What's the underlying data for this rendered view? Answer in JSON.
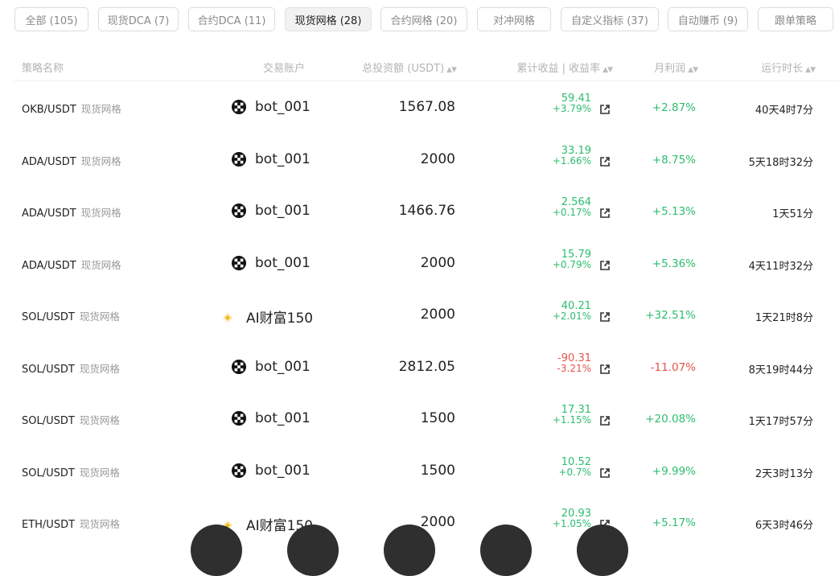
{
  "tabs": [
    {
      "label": "全部 (105)",
      "active": false
    },
    {
      "label": "现货DCA (7)",
      "active": false
    },
    {
      "label": "合约DCA (11)",
      "active": false
    },
    {
      "label": "现货网格 (28)",
      "active": true
    },
    {
      "label": "合约网格 (20)",
      "active": false
    },
    {
      "label": "对冲网格",
      "active": false
    },
    {
      "label": "自定义指标 (37)",
      "active": false
    },
    {
      "label": "自动赚币 (9)",
      "active": false
    },
    {
      "label": "跟单策略",
      "active": false
    }
  ],
  "columns": {
    "name": "策略名称",
    "account": "交易账户",
    "invest": "总投资额 (USDT)",
    "earnings": "累计收益 | 收益率",
    "monthly": "月利润",
    "runtime": "运行时长"
  },
  "rows": [
    {
      "pair": "OKB/USDT",
      "type": "现货网格",
      "account": "bot_001",
      "account_icon": "okx-icon",
      "invest": "1567.08",
      "profit": "59.41",
      "rate": "+3.79%",
      "monthly": "+2.87%",
      "runtime": "40天4时7分",
      "trend": "up"
    },
    {
      "pair": "ADA/USDT",
      "type": "现货网格",
      "account": "bot_001",
      "account_icon": "okx-icon",
      "invest": "2000",
      "profit": "33.19",
      "rate": "+1.66%",
      "monthly": "+8.75%",
      "runtime": "5天18时32分",
      "trend": "up"
    },
    {
      "pair": "ADA/USDT",
      "type": "现货网格",
      "account": "bot_001",
      "account_icon": "okx-icon",
      "invest": "1466.76",
      "profit": "2.564",
      "rate": "+0.17%",
      "monthly": "+5.13%",
      "runtime": "1天51分",
      "trend": "up"
    },
    {
      "pair": "ADA/USDT",
      "type": "现货网格",
      "account": "bot_001",
      "account_icon": "okx-icon",
      "invest": "2000",
      "profit": "15.79",
      "rate": "+0.79%",
      "monthly": "+5.36%",
      "runtime": "4天11时32分",
      "trend": "up"
    },
    {
      "pair": "SOL/USDT",
      "type": "现货网格",
      "account": "AI财富150",
      "account_icon": "binance-icon",
      "invest": "2000",
      "profit": "40.21",
      "rate": "+2.01%",
      "monthly": "+32.51%",
      "runtime": "1天21时8分",
      "trend": "up"
    },
    {
      "pair": "SOL/USDT",
      "type": "现货网格",
      "account": "bot_001",
      "account_icon": "okx-icon",
      "invest": "2812.05",
      "profit": "-90.31",
      "rate": "-3.21%",
      "monthly": "-11.07%",
      "runtime": "8天19时44分",
      "trend": "down"
    },
    {
      "pair": "SOL/USDT",
      "type": "现货网格",
      "account": "bot_001",
      "account_icon": "okx-icon",
      "invest": "1500",
      "profit": "17.31",
      "rate": "+1.15%",
      "monthly": "+20.08%",
      "runtime": "1天17时57分",
      "trend": "up"
    },
    {
      "pair": "SOL/USDT",
      "type": "现货网格",
      "account": "bot_001",
      "account_icon": "okx-icon",
      "invest": "1500",
      "profit": "10.52",
      "rate": "+0.7%",
      "monthly": "+9.99%",
      "runtime": "2天3时13分",
      "trend": "up"
    },
    {
      "pair": "ETH/USDT",
      "type": "现货网格",
      "account": "AI财富150",
      "account_icon": "binance-icon",
      "invest": "2000",
      "profit": "20.93",
      "rate": "+1.05%",
      "monthly": "+5.17%",
      "runtime": "6天3时46分",
      "trend": "up"
    }
  ],
  "colors": {
    "up": "#2dbd6e",
    "down": "#e5534b",
    "accent_binance": "#f0b90b"
  }
}
